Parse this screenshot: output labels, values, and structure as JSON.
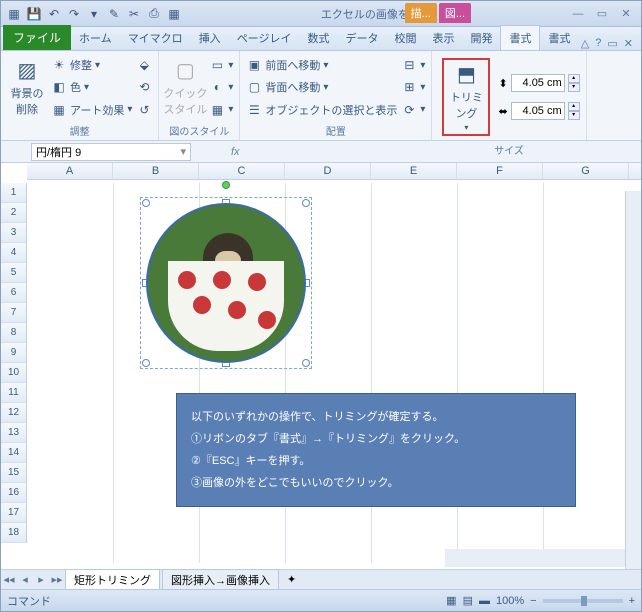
{
  "qat": {
    "title": "エクセルの画像をト..."
  },
  "context_tabs": {
    "t1": "描...",
    "t2": "図..."
  },
  "tabs": {
    "file": "ファイル",
    "items": [
      "ホーム",
      "マイマクロ",
      "挿入",
      "ページレイ",
      "数式",
      "データ",
      "校閲",
      "表示",
      "開発",
      "書式",
      "書式"
    ]
  },
  "ribbon": {
    "g1": {
      "big": "背景の\n削除",
      "r1": "修整",
      "r2": "色",
      "r3": "アート効果",
      "label": "調整"
    },
    "g2": {
      "big": "クイック\nスタイル",
      "label": "図のスタイル"
    },
    "g3": {
      "r1": "前面へ移動",
      "r2": "背面へ移動",
      "r3": "オブジェクトの選択と表示",
      "label": "配置"
    },
    "g4": {
      "big": "トリミング",
      "h": "4.05 cm",
      "w": "4.05 cm",
      "label": "サイズ"
    }
  },
  "namebox": "円/楕円 9",
  "fx": "fx",
  "cols": [
    "A",
    "B",
    "C",
    "D",
    "E",
    "F",
    "G"
  ],
  "rows": [
    "1",
    "2",
    "3",
    "4",
    "5",
    "6",
    "7",
    "8",
    "9",
    "10",
    "11",
    "12",
    "13",
    "14",
    "15",
    "16",
    "17",
    "18"
  ],
  "callout": {
    "l1": "以下のいずれかの操作で、トリミングが確定する。",
    "l2": "①リボンのタブ『書式』→『トリミング』をクリック。",
    "l3": "②『ESC』キーを押す。",
    "l4": "③画像の外をどこでもいいのでクリック。"
  },
  "sheets": {
    "nav": [
      "◂◂",
      "◂",
      "▸",
      "▸▸"
    ],
    "s1": "矩形トリミング",
    "s2": "図形挿入→画像挿入"
  },
  "status": {
    "mode": "コマンド",
    "zoom": "100%"
  }
}
